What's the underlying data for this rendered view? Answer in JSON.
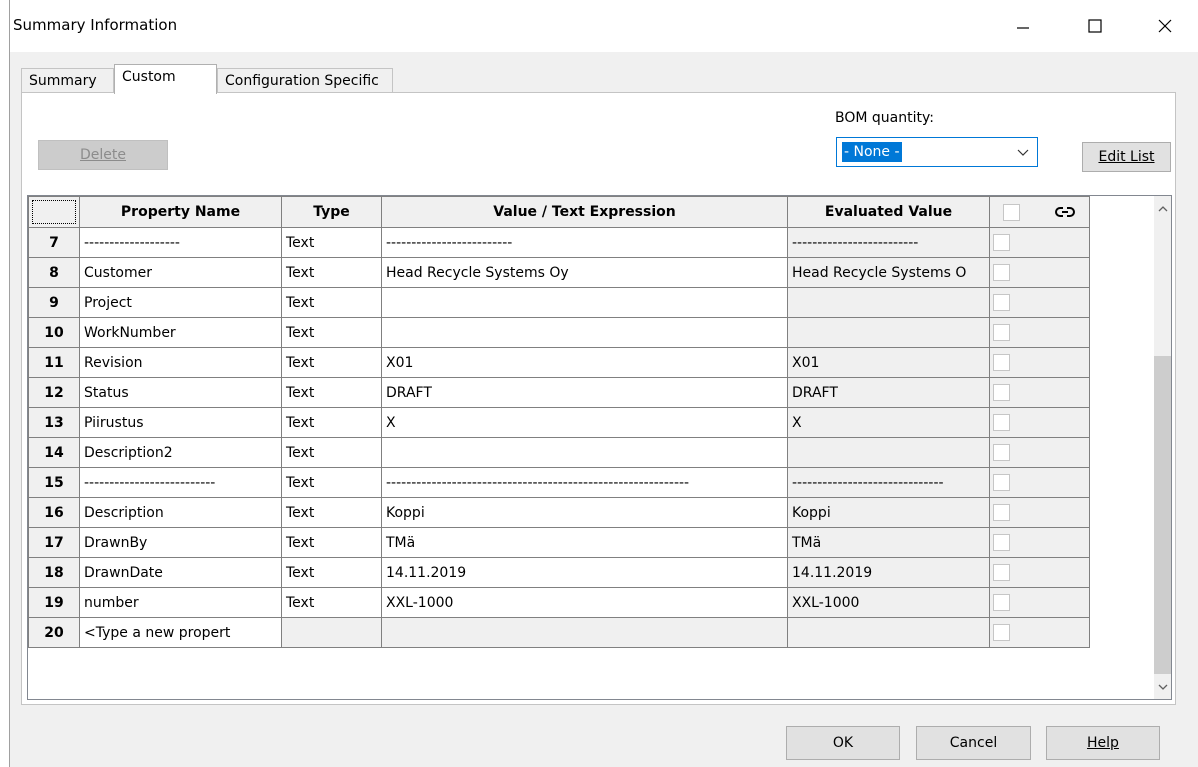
{
  "window": {
    "title": "Summary Information"
  },
  "tabs": [
    {
      "label": "Summary"
    },
    {
      "label": "Custom"
    },
    {
      "label": "Configuration Specific"
    }
  ],
  "toolbar": {
    "delete_label": "Delete",
    "bom_label": "BOM quantity:",
    "bom_value": "- None -",
    "edit_list_label": "Edit List"
  },
  "grid": {
    "headers": {
      "name": "Property Name",
      "type": "Type",
      "value": "Value / Text Expression",
      "evaluated": "Evaluated Value"
    },
    "rows": [
      {
        "num": "7",
        "name": "-------------------",
        "type": "Text",
        "value": "-------------------------",
        "evaluated": "-------------------------"
      },
      {
        "num": "8",
        "name": "Customer",
        "type": "Text",
        "value": "Head Recycle Systems Oy",
        "evaluated": "Head Recycle Systems O"
      },
      {
        "num": "9",
        "name": "Project",
        "type": "Text",
        "value": "",
        "evaluated": ""
      },
      {
        "num": "10",
        "name": "WorkNumber",
        "type": "Text",
        "value": "",
        "evaluated": ""
      },
      {
        "num": "11",
        "name": "Revision",
        "type": "Text",
        "value": "X01",
        "evaluated": "X01"
      },
      {
        "num": "12",
        "name": "Status",
        "type": "Text",
        "value": "DRAFT",
        "evaluated": "DRAFT"
      },
      {
        "num": "13",
        "name": "Piirustus",
        "type": "Text",
        "value": "X",
        "evaluated": "X"
      },
      {
        "num": "14",
        "name": "Description2",
        "type": "Text",
        "value": "",
        "evaluated": ""
      },
      {
        "num": "15",
        "name": "--------------------------",
        "type": "Text",
        "value": "------------------------------------------------------------",
        "evaluated": "------------------------------"
      },
      {
        "num": "16",
        "name": "Description",
        "type": "Text",
        "value": "Koppi",
        "evaluated": "Koppi"
      },
      {
        "num": "17",
        "name": "DrawnBy",
        "type": "Text",
        "value": "TMä",
        "evaluated": "TMä"
      },
      {
        "num": "18",
        "name": "DrawnDate",
        "type": "Text",
        "value": "14.11.2019",
        "evaluated": "14.11.2019"
      },
      {
        "num": "19",
        "name": "number",
        "type": "Text",
        "value": "XXL-1000",
        "evaluated": "XXL-1000"
      },
      {
        "num": "20",
        "name": "<Type a new propert",
        "type": "",
        "value": "",
        "evaluated": ""
      }
    ]
  },
  "footer": {
    "ok_label": "OK",
    "cancel_label": "Cancel",
    "help_label": "Help"
  }
}
